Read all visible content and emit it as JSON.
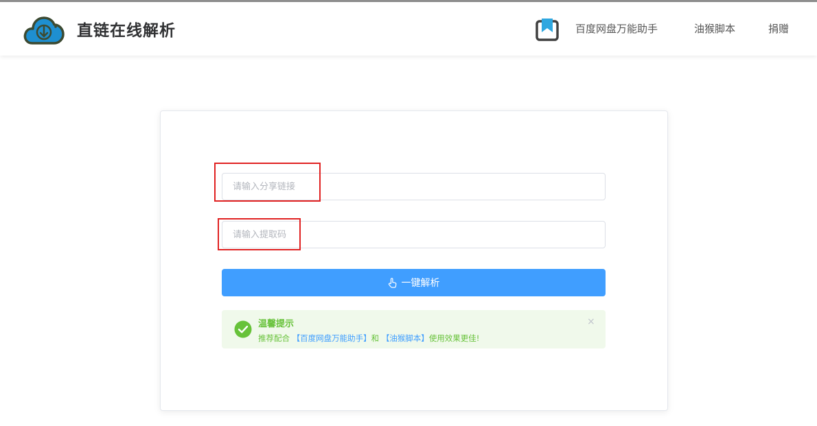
{
  "header": {
    "site_title": "直链在线解析",
    "nav": [
      {
        "label": "百度网盘万能助手"
      },
      {
        "label": "油猴脚本"
      },
      {
        "label": "捐赠"
      }
    ]
  },
  "form": {
    "share_link": {
      "value": "",
      "placeholder": "请输入分享链接"
    },
    "extract_code": {
      "value": "",
      "placeholder": "请输入提取码"
    },
    "submit_label": "一键解析"
  },
  "alert": {
    "title": "温馨提示",
    "desc_prefix": "推荐配合",
    "link1": "【百度网盘万能助手】",
    "desc_mid": "和",
    "link2": "【油猴脚本】",
    "desc_suffix": "使用效果更佳!",
    "close": "×"
  },
  "colors": {
    "primary": "#409eff",
    "success": "#67c23a",
    "success_bg": "#f0f9eb",
    "highlight": "#e02020"
  },
  "icons": {
    "logo": "cloud-download-icon",
    "nav": "bookmark-icon",
    "button": "pointing-hand-icon",
    "alert": "check-circle-icon"
  }
}
